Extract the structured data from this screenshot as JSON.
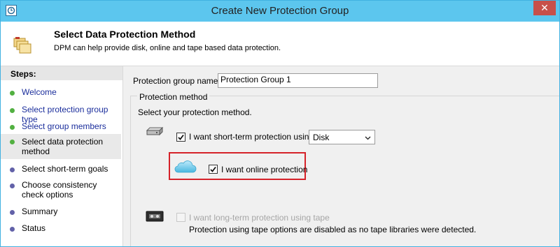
{
  "window": {
    "title": "Create New Protection Group",
    "close_label": "✕"
  },
  "header": {
    "title": "Select Data Protection Method",
    "subtitle": "DPM can help provide disk, online and tape based data protection."
  },
  "steps": {
    "title": "Steps:",
    "items": [
      {
        "label": "Welcome",
        "status": "done"
      },
      {
        "label": "Select protection group type",
        "status": "done"
      },
      {
        "label": "Select group members",
        "status": "done"
      },
      {
        "label": "Select data protection method",
        "status": "current"
      },
      {
        "label": "Select short-term goals",
        "status": "pending"
      },
      {
        "label": "Choose consistency check options",
        "status": "pending"
      },
      {
        "label": "Summary",
        "status": "pending"
      },
      {
        "label": "Status",
        "status": "pending"
      }
    ]
  },
  "form": {
    "group_name_label": "Protection group name:",
    "group_name_value": "Protection Group 1",
    "method_group_title": "Protection method",
    "method_desc": "Select your protection method.",
    "short_term": {
      "label": "I want short-term protection using:",
      "checked": true,
      "selected": "Disk"
    },
    "online": {
      "label": "I want online protection",
      "checked": true
    },
    "tape": {
      "label": "I want long-term protection using tape",
      "checked": false,
      "enabled": false,
      "note": "Protection using tape options are disabled as no tape libraries were detected."
    }
  },
  "colors": {
    "titlebar": "#5cc6ee",
    "step_done": "#52b041",
    "step_pending": "#6261a8",
    "link": "#1b2e9c",
    "highlight_border": "#d52229"
  },
  "icons": [
    "app-icon",
    "close-icon",
    "folders-icon",
    "hard-drive-icon",
    "cloud-icon",
    "tape-drive-icon",
    "checkmark-icon",
    "chevron-down-icon"
  ]
}
